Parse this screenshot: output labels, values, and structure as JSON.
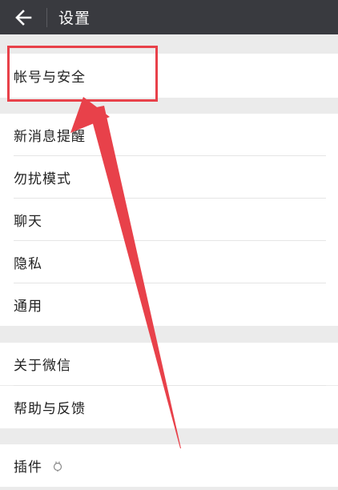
{
  "header": {
    "title": "设置",
    "back_icon": "arrow-left-icon",
    "background": "#393a3f"
  },
  "groups": [
    {
      "items": [
        {
          "label": "帐号与安全"
        }
      ]
    },
    {
      "items": [
        {
          "label": "新消息提醒"
        },
        {
          "label": "勿扰模式"
        },
        {
          "label": "聊天"
        },
        {
          "label": "隐私"
        },
        {
          "label": "通用"
        }
      ]
    },
    {
      "items": [
        {
          "label": "关于微信"
        },
        {
          "label": "帮助与反馈"
        }
      ]
    },
    {
      "items": [
        {
          "label": "插件",
          "icon": "plugin-icon"
        }
      ]
    }
  ],
  "annotation": {
    "highlight_color": "#e8414a"
  }
}
